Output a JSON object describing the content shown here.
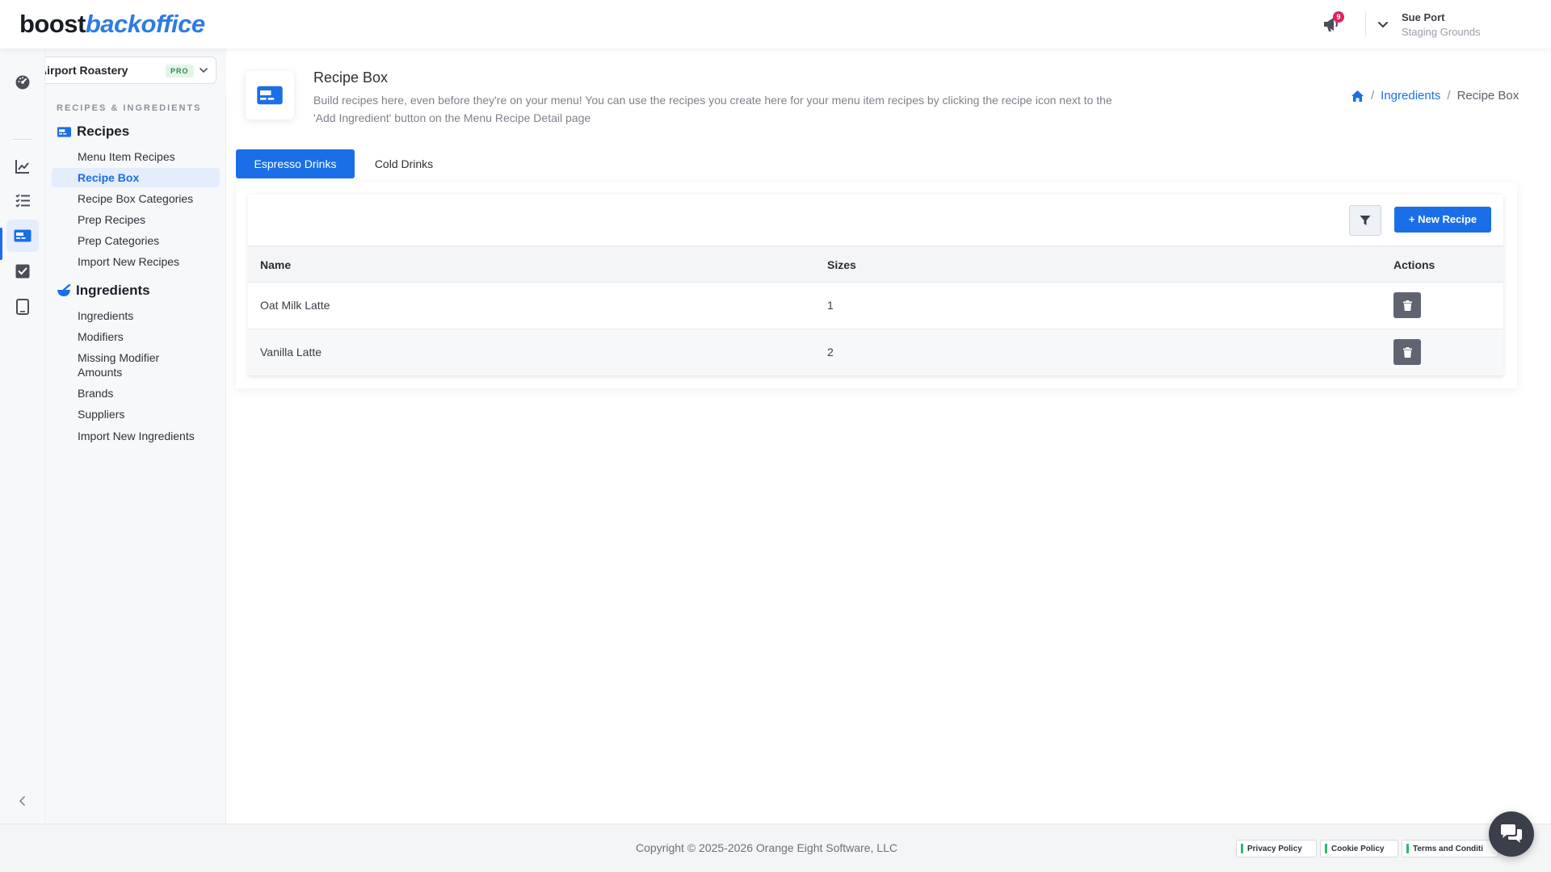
{
  "header": {
    "logo_brand": "boost",
    "logo_product": "backoffice",
    "notification_count": "9",
    "user_name": "Sue Port",
    "user_org": "Staging Grounds"
  },
  "location": {
    "name": "Airport Roastery",
    "tier_badge": "PRO"
  },
  "sidebar": {
    "section_title": "RECIPES & INGREDIENTS",
    "recipes_group": "Recipes",
    "recipes_items": [
      "Menu Item Recipes",
      "Recipe Box",
      "Recipe Box Categories",
      "Prep Recipes",
      "Prep Categories",
      "Import New Recipes"
    ],
    "ingredients_group": "Ingredients",
    "ingredients_items": [
      "Ingredients",
      "Modifiers",
      "Missing Modifier Amounts",
      "Brands",
      "Suppliers",
      "Import New Ingredients"
    ],
    "active_item": "Recipe Box"
  },
  "rail": {
    "icons": [
      "dashboard-icon",
      "chart-icon",
      "checklist-icon",
      "recipe-card-icon",
      "check-square-icon",
      "tablet-icon"
    ],
    "active_icon": "recipe-card-icon"
  },
  "page": {
    "title": "Recipe Box",
    "description": "Build recipes here, even before they're on your menu! You can use the recipes you create here for your menu item recipes by clicking the recipe icon next to the 'Add Ingredient' button on the Menu Recipe Detail page"
  },
  "breadcrumb": {
    "items": [
      "Ingredients",
      "Recipe Box"
    ]
  },
  "tabs": [
    {
      "label": "Espresso Drinks",
      "active": true
    },
    {
      "label": "Cold Drinks",
      "active": false
    }
  ],
  "toolbar": {
    "new_recipe_label": "+ New Recipe"
  },
  "table": {
    "columns": [
      "Name",
      "Sizes",
      "Actions"
    ],
    "rows": [
      {
        "name": "Oat Milk Latte",
        "sizes": "1"
      },
      {
        "name": "Vanilla Latte",
        "sizes": "2"
      }
    ]
  },
  "footer": {
    "copyright": "Copyright © 2025-2026 Orange Eight Software, LLC",
    "policies": [
      "Privacy Policy",
      "Cookie Policy",
      "Terms and Conditi"
    ]
  },
  "colors": {
    "accent": "#1a6fe8",
    "badge": "#e0245e",
    "pro_badge": "#2a8a4e"
  }
}
